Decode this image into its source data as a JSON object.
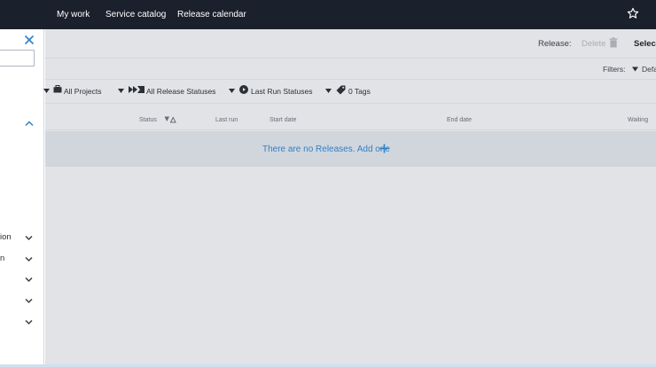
{
  "nav": {
    "items": [
      "My work",
      "Service catalog",
      "Release calendar"
    ],
    "favorite_icon": "star-icon"
  },
  "sidebar": {
    "rows": [
      {
        "label": "ion"
      },
      {
        "label": "n"
      },
      {
        "label": ""
      },
      {
        "label": ""
      },
      {
        "label": ""
      }
    ]
  },
  "toolbar": {
    "release_label": "Release:",
    "delete_label": "Delete",
    "select_label": "Select"
  },
  "filters": {
    "label": "Filters:",
    "value": "Default"
  },
  "filter_bar": {
    "projects": "All Projects",
    "release_statuses": "All Release Statuses",
    "run_statuses": "Last Run Statuses",
    "tags": "0 Tags"
  },
  "table": {
    "columns": [
      "Status",
      "Last run",
      "Start date",
      "End date",
      "Waiting"
    ],
    "empty_message": "There are no Releases. Add one"
  },
  "colors": {
    "topbar": "#1a202c",
    "overlay": "#e2e3e6",
    "empty_row": "#d1d6dc",
    "link": "#2f80c9"
  }
}
